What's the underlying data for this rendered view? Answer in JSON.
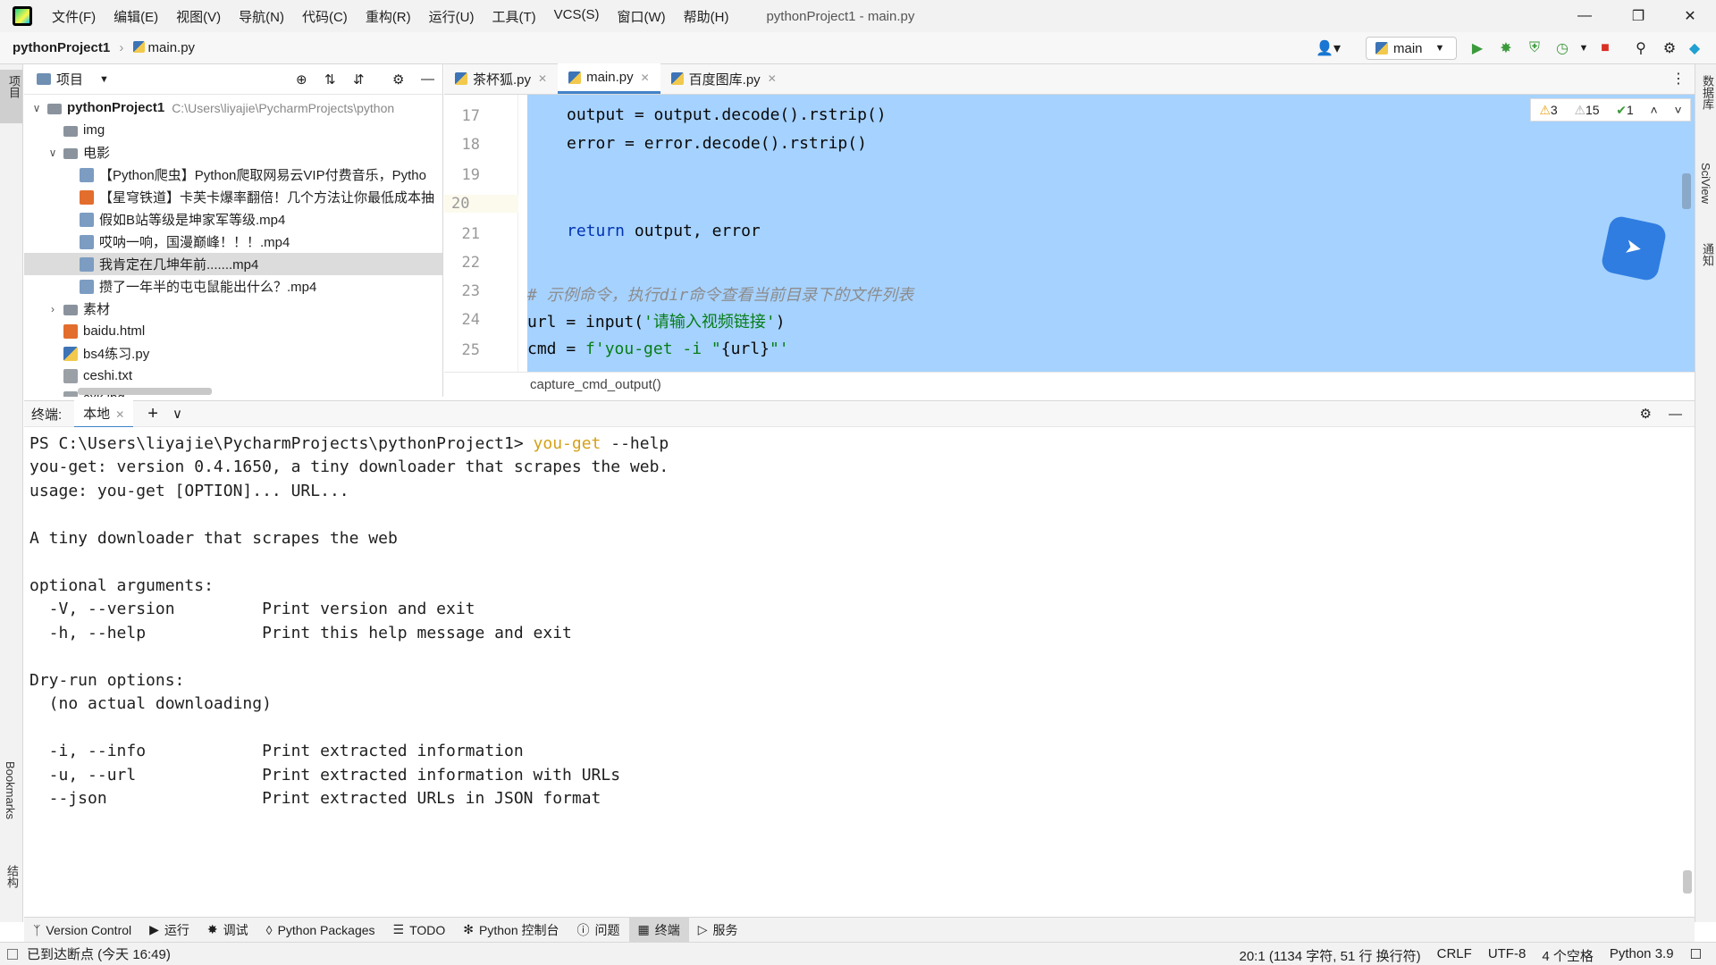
{
  "window": {
    "title": "pythonProject1 - main.py",
    "menu": [
      "文件(F)",
      "编辑(E)",
      "视图(V)",
      "导航(N)",
      "代码(C)",
      "重构(R)",
      "运行(U)",
      "工具(T)",
      "VCS(S)",
      "窗口(W)",
      "帮助(H)"
    ]
  },
  "navbar": {
    "project": "pythonProject1",
    "file": "main.py",
    "run_config": "main"
  },
  "left_strip": {
    "project": "项目",
    "bookmarks": "Bookmarks",
    "structure": "结构"
  },
  "right_strip": {
    "database": "数据库",
    "sciview": "SciView",
    "notifications": "通知"
  },
  "project_panel": {
    "title": "项目",
    "root": {
      "name": "pythonProject1",
      "path": "C:\\Users\\liyajie\\PycharmProjects\\python"
    },
    "items": [
      {
        "label": "img",
        "type": "folder",
        "indent": 1
      },
      {
        "label": "电影",
        "type": "folder",
        "indent": 1,
        "expanded": true
      },
      {
        "label": "【Python爬虫】Python爬取网易云VIP付费音乐，Pytho",
        "type": "mp4",
        "indent": 2
      },
      {
        "label": "【星穹铁道】卡芙卡爆率翻倍！几个方法让你最低成本抽",
        "type": "html",
        "indent": 2
      },
      {
        "label": "假如B站等级是坤家军等级.mp4",
        "type": "mp4",
        "indent": 2
      },
      {
        "label": "哎呐一响，国漫巅峰！！！.mp4",
        "type": "mp4",
        "indent": 2
      },
      {
        "label": "我肯定在几坤年前.......mp4",
        "type": "mp4",
        "indent": 2,
        "selected": true
      },
      {
        "label": "攒了一年半的屯屯鼠能出什么？.mp4",
        "type": "mp4",
        "indent": 2
      },
      {
        "label": "素材",
        "type": "folder",
        "indent": 1,
        "collapsed": true
      },
      {
        "label": "baidu.html",
        "type": "html",
        "indent": 1
      },
      {
        "label": "bs4练习.py",
        "type": "py",
        "indent": 1
      },
      {
        "label": "ceshi.txt",
        "type": "txt",
        "indent": 1
      },
      {
        "label": "cxk.jpg",
        "type": "txt",
        "indent": 1
      }
    ]
  },
  "editor": {
    "tabs": [
      {
        "label": "茶杯狐.py",
        "active": false
      },
      {
        "label": "main.py",
        "active": true
      },
      {
        "label": "百度图库.py",
        "active": false
      }
    ],
    "line_numbers": [
      "17",
      "18",
      "19",
      "20",
      "21",
      "22",
      "23",
      "24",
      "25"
    ],
    "inspections": {
      "warnings": "3",
      "weak_warnings": "15",
      "ok": "1"
    },
    "breadcrumb": "capture_cmd_output()"
  },
  "terminal": {
    "label": "终端:",
    "tab": "本地",
    "prompt": "PS C:\\Users\\liyajie\\PycharmProjects\\pythonProject1> ",
    "cmd": "you-get",
    "args": " --help",
    "lines": [
      "you-get: version 0.4.1650, a tiny downloader that scrapes the web.",
      "usage: you-get [OPTION]... URL...",
      "",
      "A tiny downloader that scrapes the web",
      "",
      "optional arguments:",
      "  -V, --version         Print version and exit",
      "  -h, --help            Print this help message and exit",
      "",
      "Dry-run options:",
      "  (no actual downloading)",
      "",
      "  -i, --info            Print extracted information",
      "  -u, --url             Print extracted information with URLs",
      "  --json                Print extracted URLs in JSON format"
    ]
  },
  "tool_windows": [
    "Version Control",
    "运行",
    "调试",
    "Python Packages",
    "TODO",
    "Python 控制台",
    "问题",
    "终端",
    "服务"
  ],
  "status": {
    "left": "已到达断点 (今天 16:49)",
    "position": "20:1 (1134 字符, 51 行 换行符)",
    "line_sep": "CRLF",
    "encoding": "UTF-8",
    "indent": "4 个空格",
    "interpreter": "Python 3.9"
  }
}
